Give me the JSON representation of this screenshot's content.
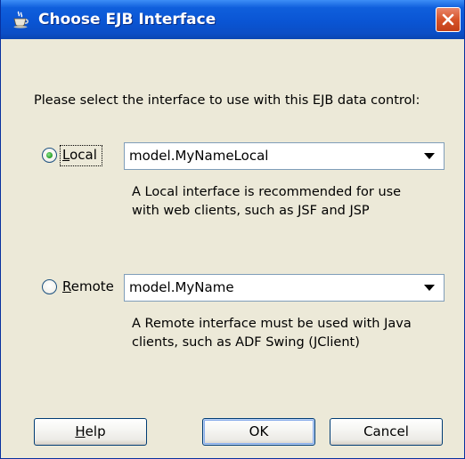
{
  "dialog": {
    "title": "Choose EJB Interface",
    "prompt": "Please select the interface to use with this EJB data control:"
  },
  "options": {
    "local": {
      "mnemonic": "L",
      "label_rest": "ocal",
      "selected": true,
      "combo_value": "model.MyNameLocal",
      "help_line1": "A Local interface is recommended for use",
      "help_line2": "with web clients, such as JSF and JSP"
    },
    "remote": {
      "mnemonic": "R",
      "label_rest": "emote",
      "selected": false,
      "combo_value": "model.MyName",
      "help_line1": "A Remote interface must be used with Java",
      "help_line2": "clients, such as ADF Swing (JClient)"
    }
  },
  "buttons": {
    "help_mnemonic": "H",
    "help_rest": "elp",
    "ok": "OK",
    "cancel": "Cancel"
  },
  "icons": {
    "title": "coffee-cup-icon",
    "close": "close-icon",
    "dropdown": "chevron-down-icon"
  },
  "colors": {
    "titlebar": "#0a55d4",
    "close_button": "#d7542a",
    "dialog_bg": "#ece9d8",
    "radio_selected": "#30a630"
  }
}
